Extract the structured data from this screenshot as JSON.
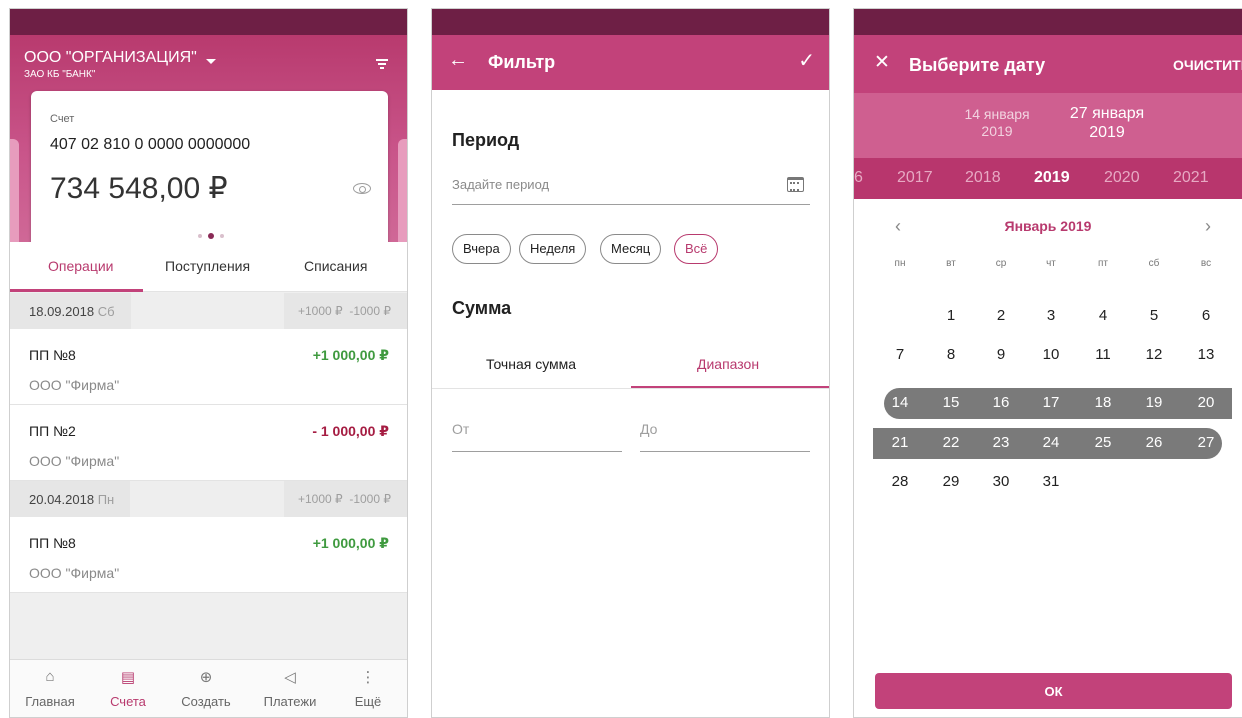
{
  "colors": {
    "accent": "#c2427a",
    "status_bar": "#6e1f45",
    "income": "#3f9a3f",
    "expense": "#a51c42",
    "range_highlight": "#7a7a7a"
  },
  "accounts_screen": {
    "org_name": "ООО \"ОРГАНИЗАЦИЯ\"",
    "bank_name": "ЗАО КБ \"БАНК\"",
    "card": {
      "label": "Счет",
      "account_number": "407 02 810 0 0000 0000000",
      "balance": "734 548,00 ₽",
      "page_index": 2,
      "page_count": 3
    },
    "tabs": [
      "Операции",
      "Поступления",
      "Списания"
    ],
    "active_tab": 0,
    "groups": [
      {
        "date": "18.09.2018",
        "weekday": "Сб",
        "income_total": "+1000 ₽",
        "expense_total": "-1000 ₽",
        "items": [
          {
            "title": "ПП №8",
            "counterparty": "ООО \"Фирма\"",
            "amount": "+1 000,00 ₽",
            "direction": "in"
          },
          {
            "title": "ПП №2",
            "counterparty": "ООО \"Фирма\"",
            "amount": "- 1 000,00 ₽",
            "direction": "out"
          }
        ]
      },
      {
        "date": "20.04.2018",
        "weekday": "Пн",
        "income_total": "+1000 ₽",
        "expense_total": "-1000 ₽",
        "items": [
          {
            "title": "ПП №8",
            "counterparty": "ООО \"Фирма\"",
            "amount": "+1 000,00 ₽",
            "direction": "in"
          }
        ]
      }
    ],
    "bottom_nav": [
      {
        "label": "Главная",
        "icon": "home-icon",
        "glyph": "⌂",
        "active": false
      },
      {
        "label": "Счета",
        "icon": "document-icon",
        "glyph": "▤",
        "active": true
      },
      {
        "label": "Создать",
        "icon": "plus-circle-icon",
        "glyph": "⊕",
        "active": false
      },
      {
        "label": "Платежи",
        "icon": "send-icon",
        "glyph": "◁",
        "active": false
      },
      {
        "label": "Ещё",
        "icon": "more-vertical-icon",
        "glyph": "⋮",
        "active": false
      }
    ]
  },
  "filter_screen": {
    "back_icon": "arrow-left-icon",
    "title": "Фильтр",
    "confirm_icon": "check-icon",
    "period_heading": "Период",
    "period_placeholder": "Задайте период",
    "period_chips": [
      "Вчера",
      "Неделя",
      "Месяц",
      "Всё"
    ],
    "selected_chip": 3,
    "sum_heading": "Сумма",
    "sum_tabs": [
      "Точная сумма",
      "Диапазон"
    ],
    "active_sum_tab": 1,
    "from_placeholder": "От",
    "to_placeholder": "До"
  },
  "date_picker": {
    "close_icon": "close-icon",
    "title": "Выберите дату",
    "clear_label": "ОЧИСТИТЬ",
    "range_from": [
      "14 января",
      "2019"
    ],
    "range_to": [
      "27 января",
      "2019"
    ],
    "years": [
      "6",
      "2017",
      "2018",
      "2019",
      "2020",
      "2021"
    ],
    "selected_year": "2019",
    "month_title": "Январь 2019",
    "weekdays": [
      "пн",
      "вт",
      "ср",
      "чт",
      "пт",
      "сб",
      "вс"
    ],
    "first_weekday_offset": 1,
    "days_in_month": 31,
    "range_start_day": 14,
    "range_end_day": 27,
    "ok_label": "ОК"
  }
}
